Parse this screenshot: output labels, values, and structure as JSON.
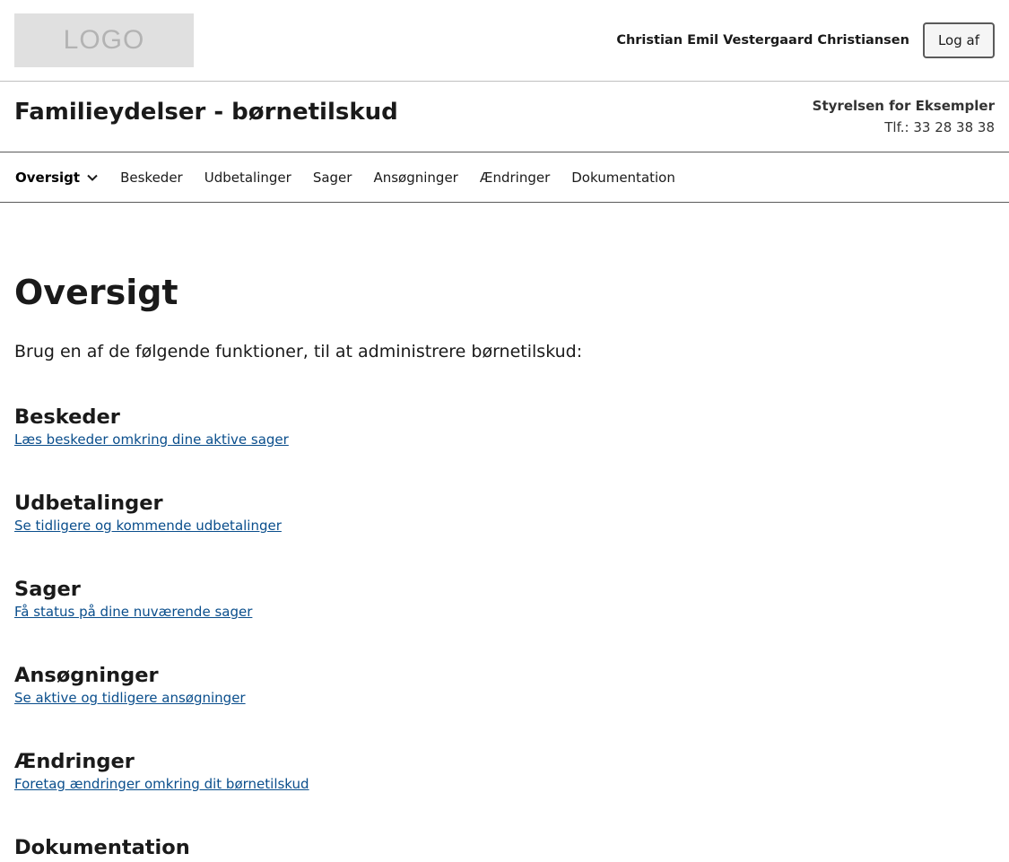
{
  "header": {
    "logo_text": "LOGO",
    "user_name": "Christian Emil Vestergaard Christiansen",
    "logout_label": "Log af"
  },
  "solution": {
    "title": "Familieydelser - børnetilskud",
    "authority_name": "Styrelsen for Eksempler",
    "authority_phone": "Tlf.: 33 28 38 38"
  },
  "nav": {
    "items": [
      {
        "label": "Oversigt",
        "active": true
      },
      {
        "label": "Beskeder"
      },
      {
        "label": "Udbetalinger"
      },
      {
        "label": "Sager"
      },
      {
        "label": "Ansøgninger"
      },
      {
        "label": "Ændringer"
      },
      {
        "label": "Dokumentation"
      }
    ]
  },
  "main": {
    "title": "Oversigt",
    "intro": "Brug en af de følgende funktioner, til at administrere børnetilskud:",
    "sections": [
      {
        "heading": "Beskeder",
        "link": "Læs beskeder omkring dine aktive sager"
      },
      {
        "heading": "Udbetalinger",
        "link": "Se tidligere og kommende udbetalinger"
      },
      {
        "heading": "Sager",
        "link": "Få status på dine nuværende sager"
      },
      {
        "heading": "Ansøgninger",
        "link": "Se aktive og tidligere ansøgninger"
      },
      {
        "heading": "Ændringer",
        "link": "Foretag ændringer omkring dit børnetilskud"
      },
      {
        "heading": "Dokumentation",
        "link": ""
      }
    ]
  },
  "colors": {
    "link": "#0a4e8c",
    "text": "#1a1a1a",
    "logo_bg": "#e0e0e0"
  }
}
